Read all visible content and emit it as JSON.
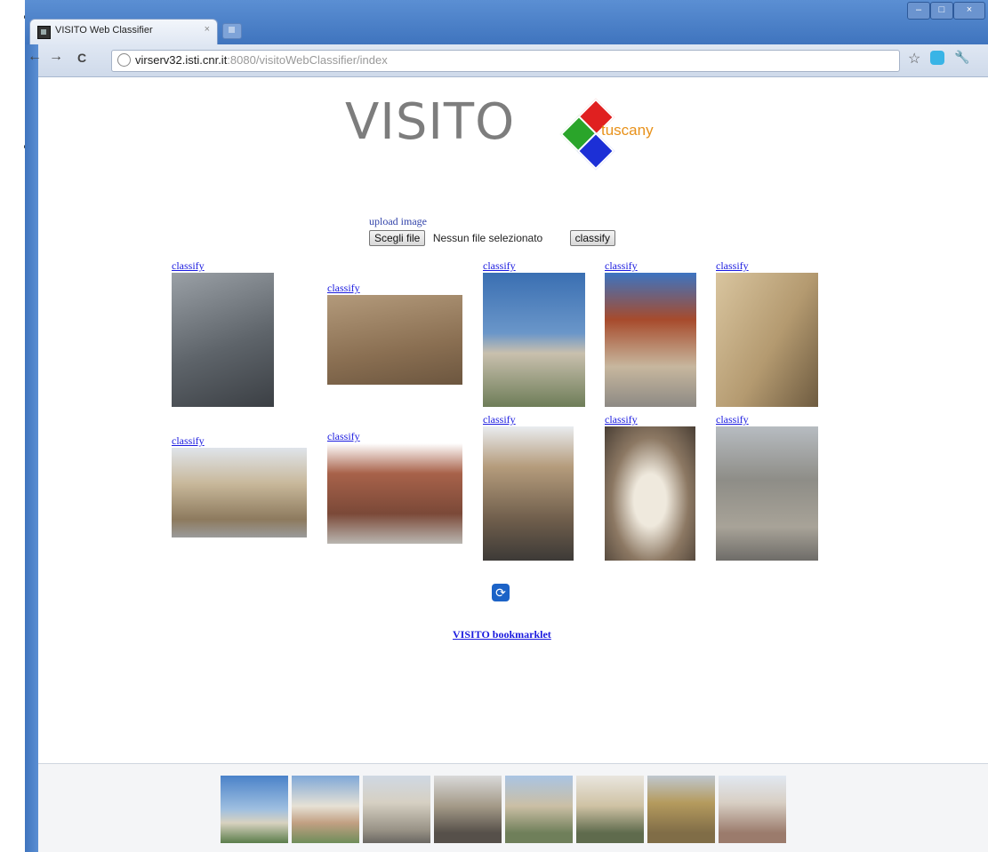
{
  "stray_chars": [
    "t",
    "t",
    "p",
    "l"
  ],
  "browser": {
    "tab_title": "VISITO Web Classifier",
    "tab_close": "×",
    "url_host": "virserv32.isti.cnr.it",
    "url_path": ":8080/visitoWebClassifier/index",
    "back": "←",
    "forward": "→",
    "reload": "C",
    "star": "☆",
    "wrench": "🔧",
    "window_controls": [
      "–",
      "□",
      "×"
    ]
  },
  "logo": {
    "word": "VISITO",
    "sub": "tuscany",
    "colors": [
      "#e02020",
      "#2aa52a",
      "#1c2fd6",
      "#e8911a"
    ]
  },
  "upload": {
    "label": "upload image",
    "choose_button": "Scegli file",
    "no_file": "Nessun file selezionato",
    "classify_button": "classify"
  },
  "gallery": {
    "link_label": "classify",
    "images": [
      "statue-facade",
      "old-tower-building",
      "statue-square",
      "duomo-dome",
      "church-wall",
      "palace-facade",
      "brick-palace-square",
      "street-view",
      "statue-niche",
      "monument-column"
    ]
  },
  "bookmarklet": "VISITO bookmarklet",
  "refresh_icon": "⟳",
  "bottom_thumbs": [
    "leaning-tower",
    "baptistery",
    "cathedral",
    "palazzo",
    "church-facade",
    "palazzo-arcade",
    "yellow-palazzo",
    "santa-maria-spina"
  ]
}
